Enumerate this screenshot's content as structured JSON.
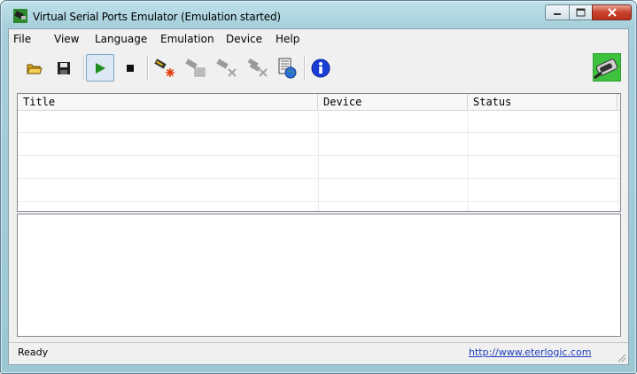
{
  "window": {
    "title": "Virtual Serial Ports Emulator (Emulation started)",
    "app_icon": "serial-cable-icon"
  },
  "menu": [
    "File",
    "View",
    "Language",
    "Emulation",
    "Device",
    "Help"
  ],
  "toolbar": {
    "buttons": [
      {
        "icon": "open-folder-icon",
        "state": "enabled"
      },
      {
        "icon": "save-icon",
        "state": "enabled"
      },
      {
        "icon": "play-icon",
        "state": "active"
      },
      {
        "icon": "stop-icon",
        "state": "enabled"
      },
      {
        "icon": "create-device-icon",
        "state": "enabled"
      },
      {
        "icon": "device-properties-icon",
        "state": "disabled"
      },
      {
        "icon": "delete-device-icon",
        "state": "disabled"
      },
      {
        "icon": "delete-all-devices-icon",
        "state": "disabled"
      },
      {
        "icon": "web-log-icon",
        "state": "enabled"
      },
      {
        "icon": "info-icon",
        "state": "enabled"
      }
    ],
    "logo_icon": "serial-connector-logo"
  },
  "device_list": {
    "columns": [
      "Title",
      "Device",
      "Status"
    ],
    "rows": []
  },
  "log": {
    "entries": []
  },
  "statusbar": {
    "status": "Ready",
    "link": "http://www.eterlogic.com"
  },
  "colors": {
    "play_green": "#1e8f1e",
    "info_blue": "#1b3fd6",
    "logo_green": "#3ec23e",
    "link_blue": "#1f3fbf"
  }
}
